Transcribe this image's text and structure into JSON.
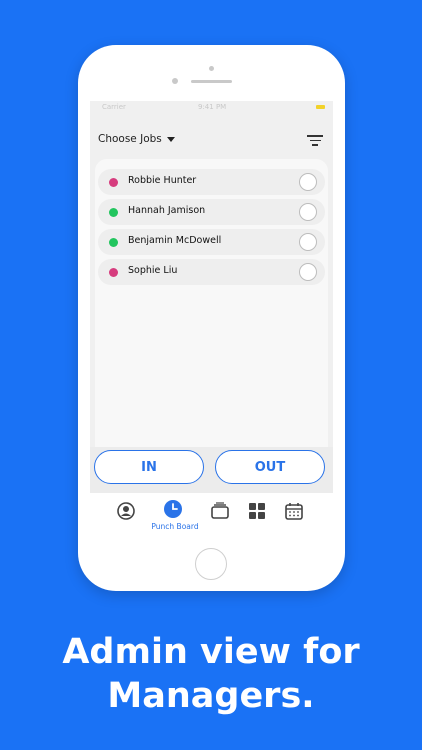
{
  "status_bar": {
    "carrier": "Carrier ",
    "time": "9:41 PM"
  },
  "header": {
    "choose_jobs_label": "Choose Jobs"
  },
  "workers": [
    {
      "name": "Robbie Hunter",
      "status_color": "#d63c7e"
    },
    {
      "name": "Hannah Jamison",
      "status_color": "#22c55e"
    },
    {
      "name": "Benjamin McDowell",
      "status_color": "#22c55e"
    },
    {
      "name": "Sophie Liu",
      "status_color": "#d63c7e"
    }
  ],
  "actions": {
    "in_label": "IN",
    "out_label": "OUT"
  },
  "tabs": {
    "active_label": "Punch Board",
    "icons": [
      "profile-icon",
      "clock-icon",
      "cards-icon",
      "grid-icon",
      "calendar-icon"
    ]
  },
  "headline": {
    "line1": "Admin view for",
    "line2": "Managers."
  },
  "colors": {
    "background": "#1a72f5",
    "accent": "#2a73e8"
  }
}
